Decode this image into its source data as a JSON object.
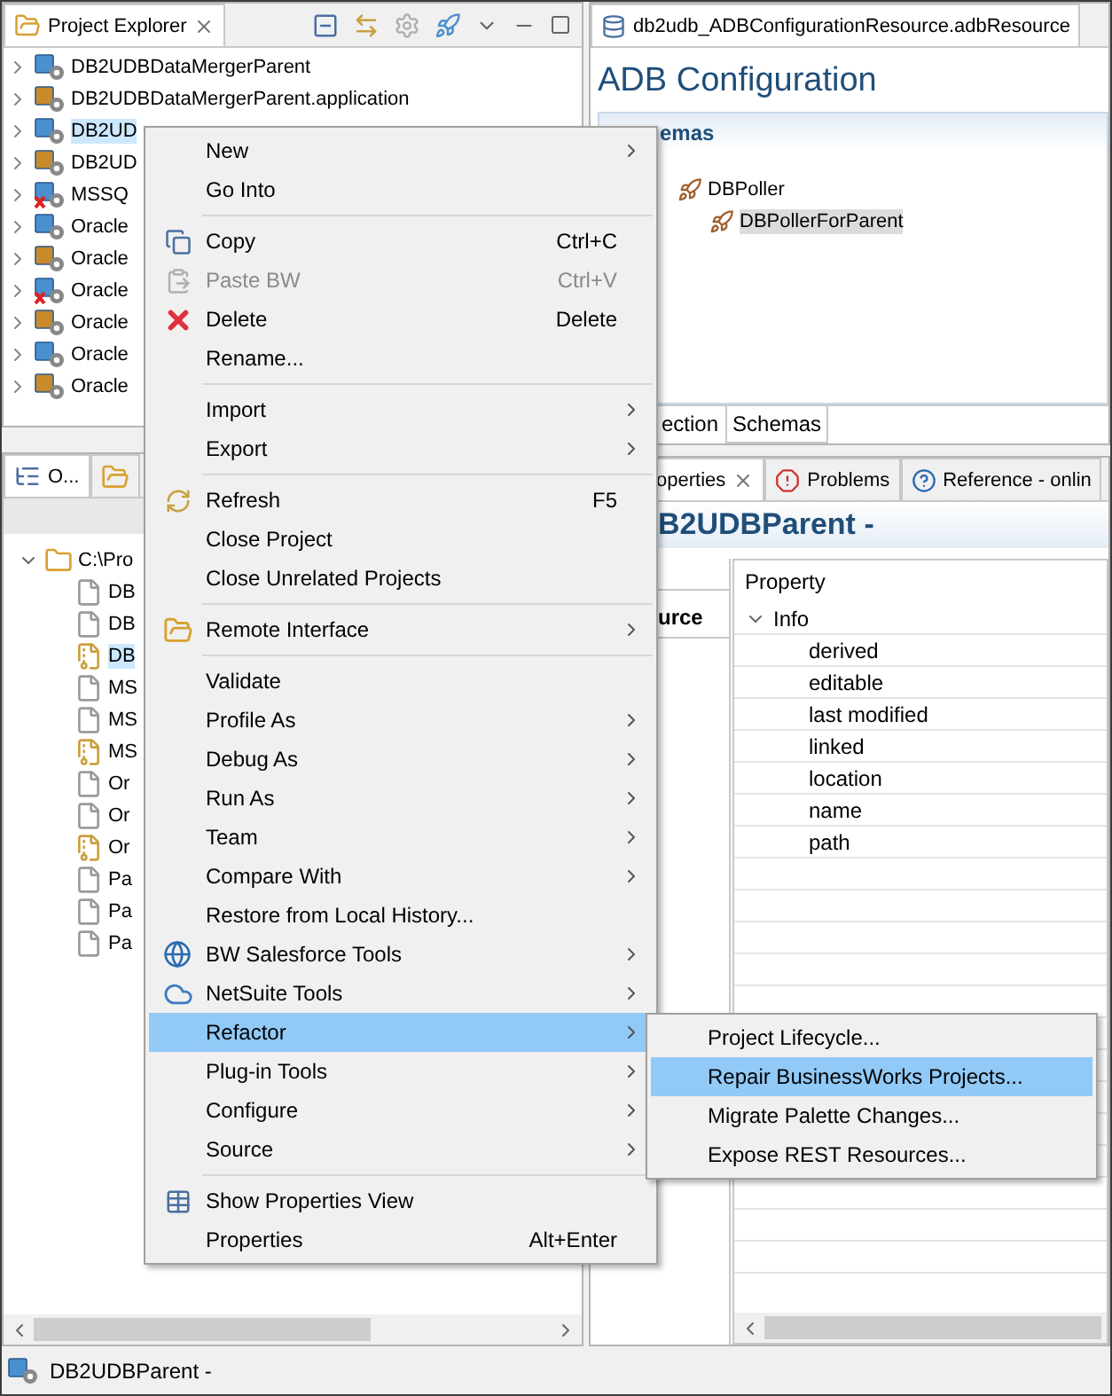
{
  "project_explorer": {
    "tab": {
      "label": "Project Explorer",
      "selected": true
    },
    "items": [
      {
        "label": "DB2UDBDataMergerParent",
        "kind": "module",
        "selected": false
      },
      {
        "label": "DB2UDBDataMergerParent.application",
        "kind": "application",
        "selected": false
      },
      {
        "label": "DB2UD",
        "kind": "module",
        "selected": true
      },
      {
        "label": "DB2UD",
        "kind": "application",
        "selected": false
      },
      {
        "label": "MSSQ",
        "kind": "error",
        "selected": false
      },
      {
        "label": "Oracle",
        "kind": "module",
        "selected": false
      },
      {
        "label": "Oracle",
        "kind": "application",
        "selected": false
      },
      {
        "label": "Oracle",
        "kind": "error",
        "selected": false
      },
      {
        "label": "Oracle",
        "kind": "application",
        "selected": false
      },
      {
        "label": "Oracle",
        "kind": "module",
        "selected": false
      },
      {
        "label": "Oracle",
        "kind": "application",
        "selected": false
      }
    ]
  },
  "outline_panel": {
    "tabs": [
      {
        "label": "O...",
        "selected": true
      },
      {
        "selected": false
      }
    ],
    "root": {
      "label": "C:\\Pro",
      "expanded": true,
      "children": [
        {
          "label": "DB",
          "kind": "file",
          "selected": false
        },
        {
          "label": "DB",
          "kind": "file",
          "selected": false
        },
        {
          "label": "DB",
          "kind": "archive",
          "selected": true
        },
        {
          "label": "MS",
          "kind": "file",
          "selected": false
        },
        {
          "label": "MS",
          "kind": "file",
          "selected": false
        },
        {
          "label": "MS",
          "kind": "archive",
          "selected": false
        },
        {
          "label": "Or",
          "kind": "file",
          "selected": false
        },
        {
          "label": "Or",
          "kind": "file",
          "selected": false
        },
        {
          "label": "Or",
          "kind": "archive",
          "selected": false
        },
        {
          "label": "Pa",
          "kind": "file",
          "selected": false
        },
        {
          "label": "Pa",
          "kind": "file",
          "selected": false
        },
        {
          "label": "Pa",
          "kind": "file",
          "selected": false
        }
      ]
    }
  },
  "editor": {
    "tab": "db2udb_ADBConfigurationResource.adbResource",
    "heading": "ADB Configuration",
    "section": "emas",
    "tree": [
      {
        "label": "DBPoller",
        "selected": false,
        "children": [
          {
            "label": "DBPollerForParent",
            "selected": true
          }
        ]
      }
    ],
    "tabs": [
      {
        "label": "ection",
        "selected": false
      },
      {
        "label": "Schemas",
        "selected": true
      }
    ]
  },
  "properties": {
    "tabs": [
      {
        "label": "operties",
        "selected": true
      },
      {
        "label": "Problems",
        "selected": false
      },
      {
        "label": "Reference - onlin",
        "selected": false
      }
    ],
    "title": "B2UDBParent -",
    "side_tab": "urce",
    "table": {
      "column": "Property",
      "group": {
        "label": "Info",
        "expanded": true,
        "rows": [
          "derived",
          "editable",
          "last modified",
          "linked",
          "location",
          "name",
          "path"
        ]
      }
    }
  },
  "context_menu": {
    "items": [
      {
        "kind": "item",
        "label": "New",
        "submenu": true,
        "disabled": false,
        "selected": false
      },
      {
        "kind": "item",
        "label": "Go Into",
        "submenu": false,
        "disabled": false,
        "selected": false
      },
      {
        "kind": "separator"
      },
      {
        "kind": "item",
        "label": "Copy",
        "shortcut": "Ctrl+C",
        "submenu": false,
        "disabled": false,
        "selected": false
      },
      {
        "kind": "item",
        "label": "Paste BW",
        "shortcut": "Ctrl+V",
        "submenu": false,
        "disabled": true,
        "selected": false
      },
      {
        "kind": "item",
        "label": "Delete",
        "shortcut": "Delete",
        "submenu": false,
        "disabled": false,
        "selected": false
      },
      {
        "kind": "item",
        "label": "Rename...",
        "submenu": false,
        "disabled": false,
        "selected": false
      },
      {
        "kind": "separator"
      },
      {
        "kind": "item",
        "label": "Import",
        "submenu": true,
        "disabled": false,
        "selected": false
      },
      {
        "kind": "item",
        "label": "Export",
        "submenu": true,
        "disabled": false,
        "selected": false
      },
      {
        "kind": "separator"
      },
      {
        "kind": "item",
        "label": "Refresh",
        "shortcut": "F5",
        "submenu": false,
        "disabled": false,
        "selected": false
      },
      {
        "kind": "item",
        "label": "Close Project",
        "submenu": false,
        "disabled": false,
        "selected": false
      },
      {
        "kind": "item",
        "label": "Close Unrelated Projects",
        "submenu": false,
        "disabled": false,
        "selected": false
      },
      {
        "kind": "separator"
      },
      {
        "kind": "item",
        "label": "Remote Interface",
        "submenu": true,
        "disabled": false,
        "selected": false
      },
      {
        "kind": "separator"
      },
      {
        "kind": "item",
        "label": "Validate",
        "submenu": false,
        "disabled": false,
        "selected": false
      },
      {
        "kind": "item",
        "label": "Profile As",
        "submenu": true,
        "disabled": false,
        "selected": false
      },
      {
        "kind": "item",
        "label": "Debug As",
        "submenu": true,
        "disabled": false,
        "selected": false
      },
      {
        "kind": "item",
        "label": "Run As",
        "submenu": true,
        "disabled": false,
        "selected": false
      },
      {
        "kind": "item",
        "label": "Team",
        "submenu": true,
        "disabled": false,
        "selected": false
      },
      {
        "kind": "item",
        "label": "Compare With",
        "submenu": true,
        "disabled": false,
        "selected": false
      },
      {
        "kind": "item",
        "label": "Restore from Local History...",
        "submenu": false,
        "disabled": false,
        "selected": false
      },
      {
        "kind": "item",
        "label": "BW Salesforce Tools",
        "submenu": true,
        "disabled": false,
        "selected": false
      },
      {
        "kind": "item",
        "label": "NetSuite Tools",
        "submenu": true,
        "disabled": false,
        "selected": false
      },
      {
        "kind": "item",
        "label": "Refactor",
        "submenu": true,
        "disabled": false,
        "selected": true
      },
      {
        "kind": "item",
        "label": "Plug-in Tools",
        "submenu": true,
        "disabled": false,
        "selected": false
      },
      {
        "kind": "item",
        "label": "Configure",
        "submenu": true,
        "disabled": false,
        "selected": false
      },
      {
        "kind": "item",
        "label": "Source",
        "submenu": true,
        "disabled": false,
        "selected": false
      },
      {
        "kind": "separator"
      },
      {
        "kind": "item",
        "label": "Show Properties View",
        "submenu": false,
        "disabled": false,
        "selected": false
      },
      {
        "kind": "item",
        "label": "Properties",
        "shortcut": "Alt+Enter",
        "submenu": false,
        "disabled": false,
        "selected": false
      }
    ]
  },
  "submenu": {
    "items": [
      {
        "label": "Project Lifecycle...",
        "selected": false
      },
      {
        "label": "Repair BusinessWorks Projects...",
        "selected": true
      },
      {
        "label": "Migrate Palette Changes...",
        "selected": false
      },
      {
        "label": "Expose REST Resources...",
        "selected": false
      }
    ]
  },
  "status_bar": {
    "label": "DB2UDBParent -"
  }
}
